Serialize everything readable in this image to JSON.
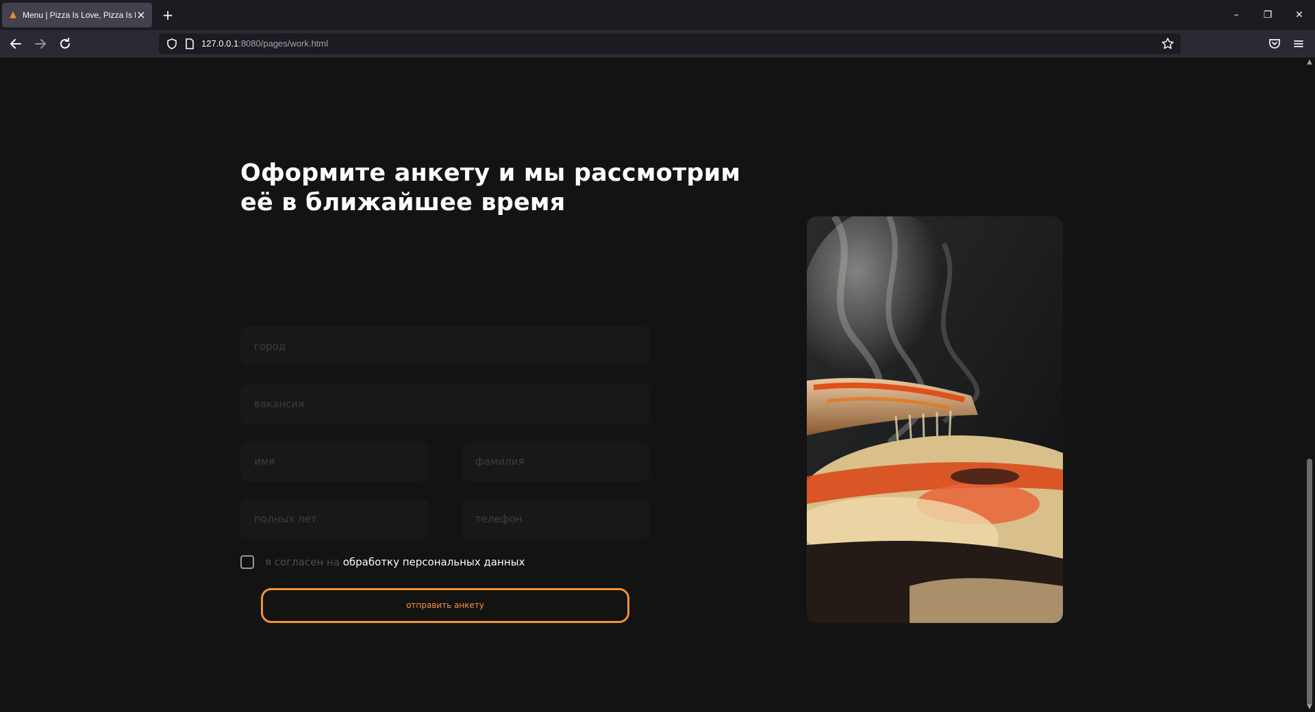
{
  "browser": {
    "tab_title": "Menu | Pizza Is Love, Pizza Is Life",
    "tab_close": "×",
    "new_tab": "+",
    "url_host": "127.0.0.1",
    "url_rest": ":8080/pages/work.html",
    "window_controls": {
      "minimize": "–",
      "restore": "❐",
      "close": "✕"
    }
  },
  "form": {
    "heading": "Оформите анкету и мы рассмотрим её в ближайшее время",
    "fields": {
      "city": "город",
      "vacancy": "вакансия",
      "first_name": "имя",
      "last_name": "фамилия",
      "age": "полных лет",
      "phone": "телефон"
    },
    "agree_prefix": "я согласен на ",
    "agree_link": "обработку персональных данных",
    "agree_checked": false,
    "submit_label": "отправить анкету"
  },
  "colors": {
    "accent": "#f7923a",
    "background": "#131313",
    "field_bg": "#181818"
  },
  "icons": [
    "pizza-favicon-icon",
    "back-arrow-icon",
    "forward-arrow-icon",
    "reload-icon",
    "shield-icon",
    "page-icon",
    "star-icon",
    "pocket-icon",
    "hamburger-menu-icon"
  ]
}
